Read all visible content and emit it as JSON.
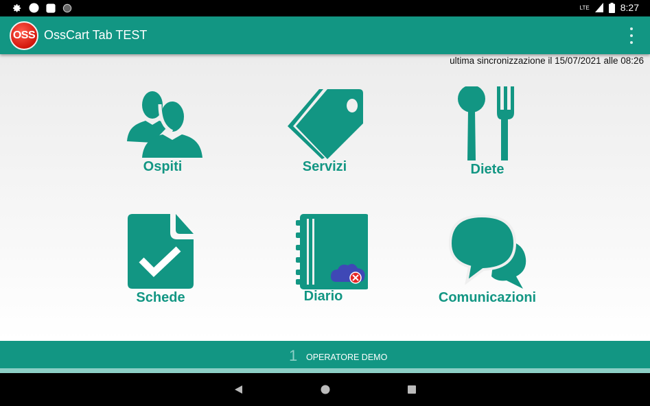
{
  "status_bar": {
    "time": "8:27",
    "network": "LTE"
  },
  "app": {
    "logo_text": "OSS",
    "title": "OssCart Tab TEST",
    "overflow_icon": "more-vert-icon"
  },
  "sync_text": "ultima sincronizzazione il 15/07/2021 alle 08:26",
  "tiles": [
    {
      "label": "Ospiti",
      "icon": "users-icon"
    },
    {
      "label": "Servizi",
      "icon": "tag-icon"
    },
    {
      "label": "Diete",
      "icon": "cutlery-icon"
    },
    {
      "label": "Schede",
      "icon": "document-check-icon"
    },
    {
      "label": "Diario",
      "icon": "notebook-icon"
    },
    {
      "label": "Comunicazioni",
      "icon": "chat-bubbles-icon"
    }
  ],
  "footer": {
    "operator_number": "1",
    "operator_name": "OPERATORE DEMO"
  },
  "colors": {
    "primary": "#129683",
    "logo_red": "#d3170c",
    "cloud": "#3f48b6"
  }
}
